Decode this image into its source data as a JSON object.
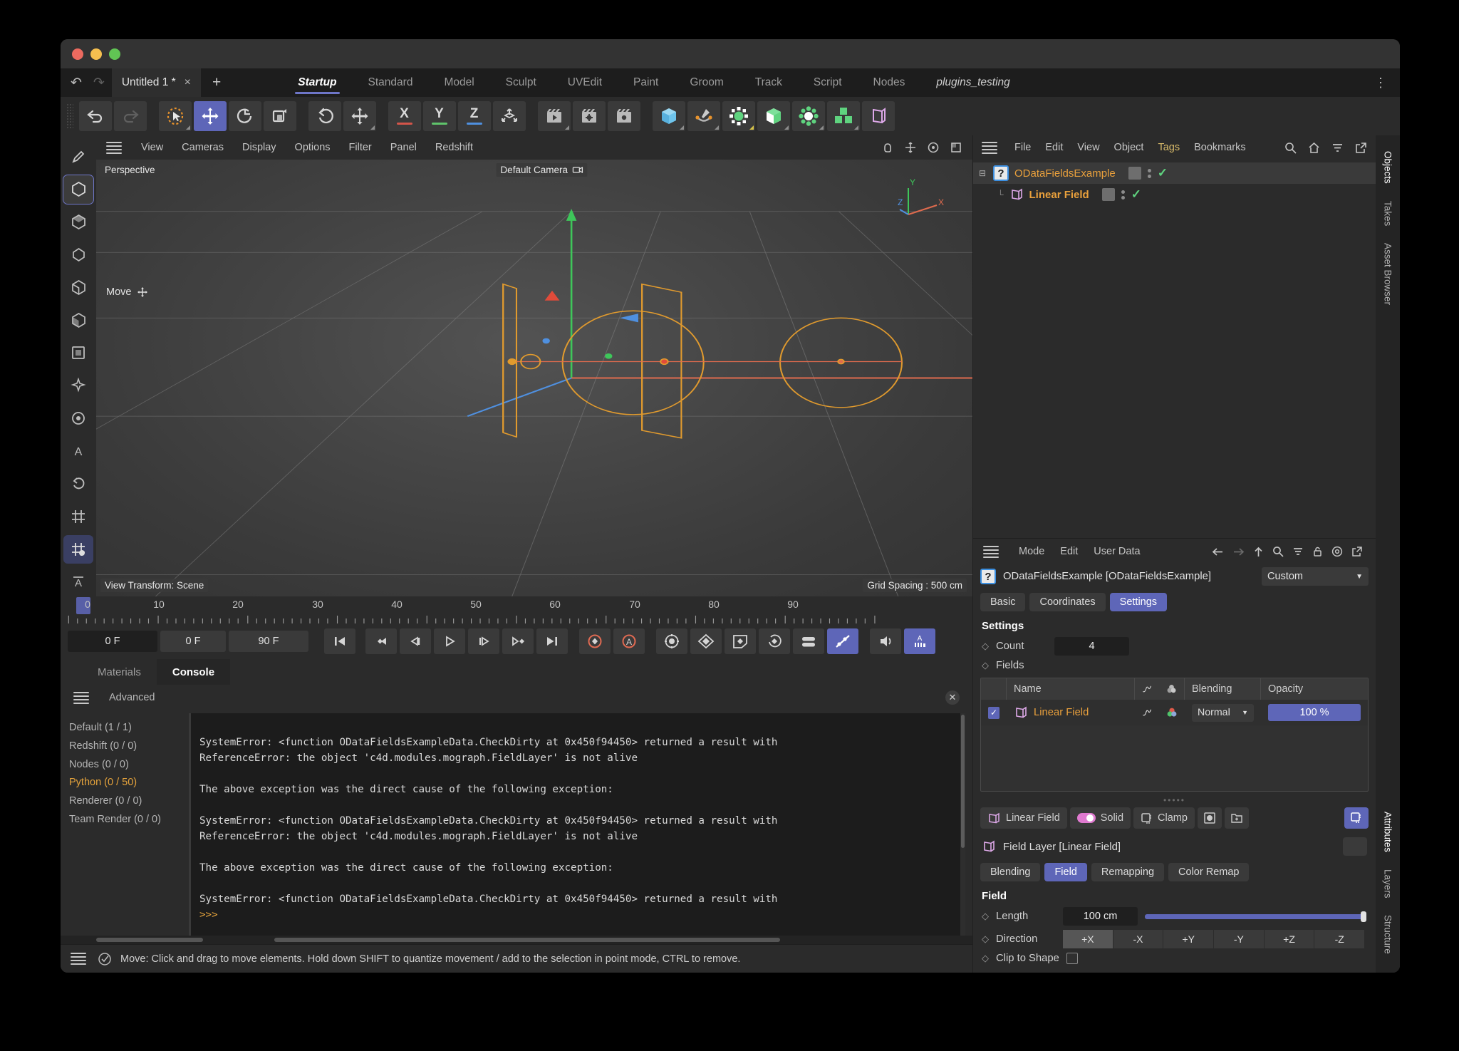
{
  "window": {
    "traffic": [
      "close",
      "minimize",
      "zoom"
    ]
  },
  "doctab": {
    "title": "Untitled 1 *",
    "close": "×",
    "add": "+",
    "undo": "↶",
    "redo": "↷"
  },
  "layouts": {
    "items": [
      "Startup",
      "Standard",
      "Model",
      "Sculpt",
      "UVEdit",
      "Paint",
      "Groom",
      "Track",
      "Script",
      "Nodes",
      "plugins_testing"
    ],
    "active": "Startup",
    "kebab": "⋮"
  },
  "main_toolbar": {
    "groups": [
      {
        "buttons": [
          {
            "name": "undo-icon",
            "glyph": "↶",
            "state": "normal"
          },
          {
            "name": "redo-icon",
            "glyph": "↷",
            "state": "disabled"
          }
        ]
      },
      {
        "buttons": [
          {
            "name": "live-selection-icon",
            "glyph": "➤",
            "state": "normal"
          },
          {
            "name": "move-tool-icon",
            "glyph": "✥",
            "state": "selected"
          },
          {
            "name": "scale-tool-icon",
            "glyph": "↺",
            "state": "normal"
          },
          {
            "name": "rotate-tool-icon",
            "glyph": "◱",
            "state": "normal"
          }
        ]
      },
      {
        "buttons": [
          {
            "name": "undo-view-icon",
            "glyph": "↺",
            "state": "normal"
          },
          {
            "name": "world-axis-icon",
            "glyph": "✥",
            "state": "normal"
          }
        ]
      },
      {
        "buttons": [
          {
            "name": "x-axis-lock",
            "glyph": "X",
            "color": "#d4554a"
          },
          {
            "name": "y-axis-lock",
            "glyph": "Y",
            "color": "#5fc46b"
          },
          {
            "name": "z-axis-lock",
            "glyph": "Z",
            "color": "#4f90e0"
          },
          {
            "name": "world-object-coord-icon",
            "glyph": "⧉"
          }
        ]
      },
      {
        "buttons": [
          {
            "name": "render-view-icon",
            "glyph": "🎬"
          },
          {
            "name": "render-to-picture-viewer-icon",
            "glyph": "▶"
          },
          {
            "name": "render-settings-icon",
            "glyph": "⚙"
          }
        ]
      },
      {
        "buttons": [
          {
            "name": "cube-primitive-icon",
            "glyph": "▢",
            "color": "#5bb6e8"
          },
          {
            "name": "spline-pen-icon",
            "glyph": "✒",
            "color": "#bdbdbd"
          },
          {
            "name": "array-generator-icon",
            "glyph": "●",
            "color": "#5fd37f"
          },
          {
            "name": "subdivision-surface-icon",
            "glyph": "◻",
            "color": "#5fd37f"
          },
          {
            "name": "mograph-icon",
            "glyph": "⚙",
            "color": "#5fd37f"
          },
          {
            "name": "cloner-icon",
            "glyph": "❖",
            "color": "#5fd37f"
          },
          {
            "name": "field-icon",
            "glyph": "◧",
            "color": "#dda8e8"
          }
        ]
      }
    ]
  },
  "left_rail": {
    "items": [
      {
        "name": "texture-axis-tool",
        "glyph": "✎"
      },
      {
        "name": "model-mode",
        "glyph": "⬡",
        "state": "selected"
      },
      {
        "name": "object-mode",
        "glyph": "⬟"
      },
      {
        "name": "point-mode",
        "glyph": "⬡"
      },
      {
        "name": "edge-mode",
        "glyph": "⬟"
      },
      {
        "name": "polygon-mode",
        "glyph": "⬟"
      },
      {
        "name": "uv-mode",
        "glyph": "▣"
      },
      {
        "name": "animation-mode",
        "glyph": "✦"
      },
      {
        "name": "viewport-solo-mode",
        "glyph": "◎"
      },
      {
        "name": "axis-mode",
        "glyph": "A"
      },
      {
        "name": "workplane-mode",
        "glyph": "↺"
      },
      {
        "name": "enable-snapping",
        "glyph": "⌗"
      },
      {
        "name": "lock-workplane",
        "glyph": "⌗",
        "state": "selected2"
      },
      {
        "name": "axis-locks",
        "glyph": "⊕"
      }
    ]
  },
  "viewport": {
    "menu": [
      "View",
      "Cameras",
      "Display",
      "Options",
      "Filter",
      "Panel",
      "Redshift"
    ],
    "projection_label": "Perspective",
    "camera_label": "Default Camera",
    "tool_hint": "Move",
    "view_transform": "View Transform: Scene",
    "grid_spacing": "Grid Spacing : 500 cm",
    "axis_gizmo": {
      "x": "X",
      "y": "Y",
      "z": "Z"
    },
    "nav_icons": [
      "pan-icon",
      "zoom-icon",
      "rotate-icon",
      "maximize-icon"
    ]
  },
  "timeline": {
    "ticks": [
      0,
      10,
      20,
      30,
      40,
      50,
      60,
      70,
      80,
      90
    ],
    "current_frame_left": "0 F",
    "current_frame_right": "0 F",
    "preview_start": "0 F",
    "preview_end": "90 F",
    "transport": [
      {
        "name": "go-to-start-button",
        "glyph": "❙◀"
      },
      {
        "name": "previous-key-button",
        "glyph": "◆◀"
      },
      {
        "name": "previous-frame-button",
        "glyph": "◁❙"
      },
      {
        "name": "play-button",
        "glyph": "▷"
      },
      {
        "name": "next-frame-button",
        "glyph": "❙▷"
      },
      {
        "name": "next-key-button",
        "glyph": "▷◆"
      },
      {
        "name": "go-to-end-button",
        "glyph": "▶❙"
      },
      {
        "name": "record-active-objects-button",
        "glyph": "◆",
        "color": "#e06a52"
      },
      {
        "name": "autokeying-button",
        "glyph": "A",
        "color": "#e06a52"
      },
      {
        "name": "keyframe-selection-button",
        "glyph": "⚙"
      },
      {
        "name": "position-key-button",
        "glyph": "❖"
      },
      {
        "name": "scale-key-button",
        "glyph": "◱"
      },
      {
        "name": "rotation-key-button",
        "glyph": "↻"
      },
      {
        "name": "parameter-key-button",
        "glyph": "≣"
      },
      {
        "name": "pla-key-button",
        "glyph": "⊘",
        "state": "selected"
      },
      {
        "name": "sound-button",
        "glyph": "🔊"
      },
      {
        "name": "animation-toolbar-button",
        "glyph": "A",
        "state": "selected"
      }
    ]
  },
  "console": {
    "tabs": [
      {
        "label": "Materials",
        "active": false
      },
      {
        "label": "Console",
        "active": true
      }
    ],
    "mode_label": "Advanced",
    "close_glyph": "✕",
    "filters": [
      {
        "label": "Default (1 / 1)",
        "highlight": false
      },
      {
        "label": "Redshift (0 / 0)",
        "highlight": false
      },
      {
        "label": "Nodes (0 / 0)",
        "highlight": false
      },
      {
        "label": "Python (0 / 50)",
        "highlight": true
      },
      {
        "label": "Renderer (0 / 0)",
        "highlight": false
      },
      {
        "label": "Team Render  (0 / 0)",
        "highlight": false
      }
    ],
    "log_lines": [
      "",
      "SystemError: <function ODataFieldsExampleData.CheckDirty at 0x450f94450> returned a result with",
      "ReferenceError: the object 'c4d.modules.mograph.FieldLayer' is not alive",
      "",
      "The above exception was the direct cause of the following exception:",
      "",
      "SystemError: <function ODataFieldsExampleData.CheckDirty at 0x450f94450> returned a result with",
      "ReferenceError: the object 'c4d.modules.mograph.FieldLayer' is not alive",
      "",
      "The above exception was the direct cause of the following exception:",
      "",
      "SystemError: <function ODataFieldsExampleData.CheckDirty at 0x450f94450> returned a result with"
    ],
    "prompt": ">>>"
  },
  "status_bar": {
    "text": "Move: Click and drag to move elements. Hold down SHIFT to quantize movement / add to the selection in point mode, CTRL to remove."
  },
  "objects_manager": {
    "menu": [
      "File",
      "Edit",
      "View",
      "Object",
      "Tags",
      "Bookmarks"
    ],
    "menu_highlight": "Tags",
    "icons": [
      "search-icon",
      "home-icon",
      "filter-icon",
      "open-window-icon"
    ],
    "rows": [
      {
        "name": "ODataFieldsExample",
        "icon": "question-mark-icon",
        "bold": false,
        "selected": true,
        "indent": 0
      },
      {
        "name": "Linear Field",
        "icon": "linear-field-icon",
        "bold": true,
        "selected": false,
        "indent": 1
      }
    ]
  },
  "attributes_manager": {
    "menu": [
      "Mode",
      "Edit",
      "User Data"
    ],
    "icons": [
      "back-arrow-icon",
      "forward-arrow-icon",
      "up-arrow-icon",
      "search-icon",
      "filter-icon",
      "lock-icon",
      "target-icon",
      "open-window-icon"
    ],
    "object_title": "ODataFieldsExample [ODataFieldsExample]",
    "scheme": "Custom",
    "tabs": [
      {
        "label": "Basic",
        "active": false
      },
      {
        "label": "Coordinates",
        "active": false
      },
      {
        "label": "Settings",
        "active": true
      }
    ],
    "settings": {
      "heading": "Settings",
      "count_label": "Count",
      "count_value": "4",
      "fields_label": "Fields",
      "field_list": {
        "columns": [
          "Name",
          "curve-icon",
          "color-icon",
          "Blending",
          "Opacity"
        ],
        "rows": [
          {
            "checked": true,
            "name": "Linear Field",
            "blending": "Normal",
            "opacity": "100 %"
          }
        ]
      }
    },
    "layer_bar": {
      "buttons": [
        {
          "label": "Linear Field",
          "icon": "linear-field-icon",
          "selected": false
        },
        {
          "label": "Solid",
          "icon": "toggle-icon",
          "selected": false
        },
        {
          "label": "Clamp",
          "icon": "clamp-icon",
          "selected": false
        },
        {
          "label": "",
          "icon": "solid-circle-icon",
          "selected": false
        },
        {
          "label": "",
          "icon": "new-folder-icon",
          "selected": false
        },
        {
          "label": "",
          "icon": "add-layer-icon",
          "selected": true
        }
      ]
    },
    "field_layer": {
      "title": "Field Layer [Linear Field]",
      "icon": "linear-field-icon",
      "tabs": [
        {
          "label": "Blending",
          "active": false
        },
        {
          "label": "Field",
          "active": true
        },
        {
          "label": "Remapping",
          "active": false
        },
        {
          "label": "Color Remap",
          "active": false
        }
      ],
      "section_heading": "Field",
      "length_label": "Length",
      "length_value": "100 cm",
      "direction_label": "Direction",
      "direction_options": [
        "+X",
        "-X",
        "+Y",
        "-Y",
        "+Z",
        "-Z"
      ],
      "direction_selected": "+X",
      "clip_label": "Clip to Shape",
      "clip_checked": false
    }
  },
  "right_tabs": {
    "top": [
      "Objects",
      "Takes",
      "Asset Browser"
    ],
    "bottom": [
      "Attributes",
      "Layers",
      "Structure"
    ]
  },
  "colors": {
    "accent": "#5e66b8",
    "orange": "#e9a03c",
    "green": "#5fd37f",
    "pink": "#dda8e8",
    "field_orange": "#e09a2e"
  }
}
